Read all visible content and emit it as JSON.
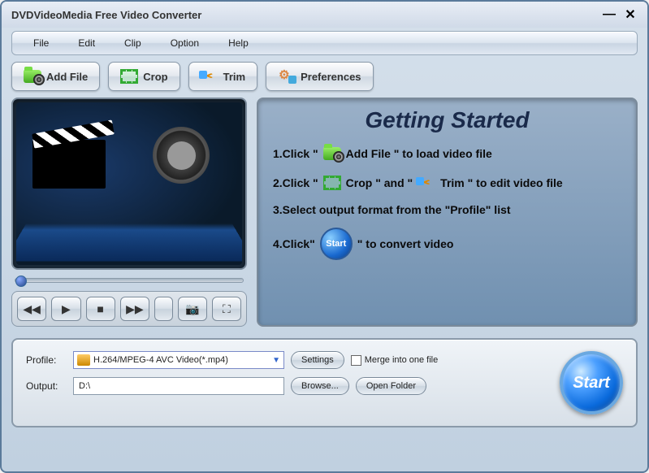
{
  "window": {
    "title": "DVDVideoMedia Free Video Converter"
  },
  "menu": {
    "file": "File",
    "edit": "Edit",
    "clip": "Clip",
    "option": "Option",
    "help": "Help"
  },
  "toolbar": {
    "add_file": "Add File",
    "crop": "Crop",
    "trim": "Trim",
    "preferences": "Preferences"
  },
  "help": {
    "title": "Getting Started",
    "step1a": "1.Click \"",
    "step1b": "Add File \" to load video file",
    "step2a": "2.Click \"",
    "step2b": "Crop \" and \"",
    "step2c": "Trim \" to edit video file",
    "step3": "3.Select output format from the \"Profile\" list",
    "step4a": "4.Click\"",
    "step4b": "\" to convert video",
    "start_icon_label": "Start"
  },
  "bottom": {
    "profile_label": "Profile:",
    "profile_value": "H.264/MPEG-4 AVC Video(*.mp4)",
    "output_label": "Output:",
    "output_value": "D:\\",
    "settings_btn": "Settings",
    "browse_btn": "Browse...",
    "open_folder_btn": "Open Folder",
    "merge_label": "Merge into one file",
    "start_btn": "Start"
  }
}
